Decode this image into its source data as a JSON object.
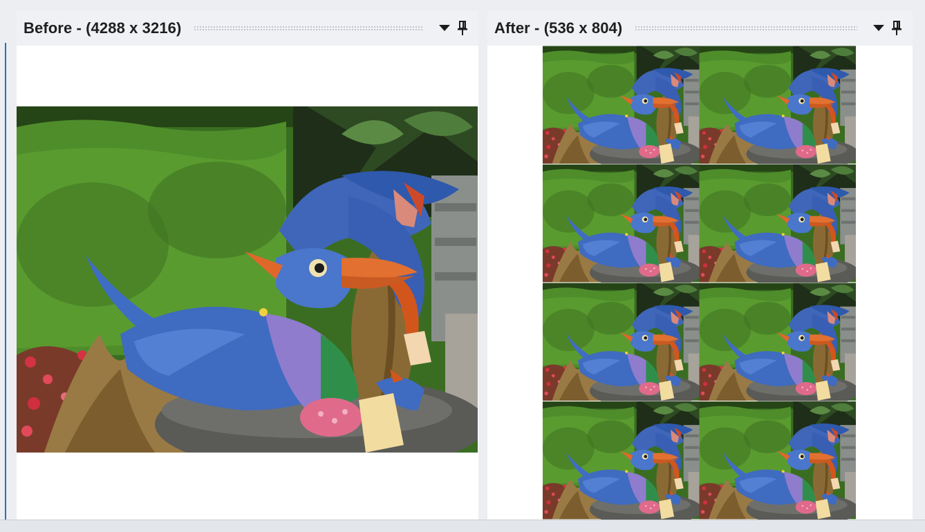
{
  "panels": {
    "before": {
      "title": "Before - (4288 x 3216)",
      "dropdown_icon": "triangle-down-icon",
      "pin_icon": "pin-icon"
    },
    "after": {
      "title": "After - (536 x 804)",
      "dropdown_icon": "triangle-down-icon",
      "pin_icon": "pin-icon",
      "tile_grid": {
        "columns": 2,
        "rows": 4
      }
    }
  },
  "colors": {
    "accent": "#2d6db8",
    "panel_header": "#eff1f4",
    "panel_body": "#ffffff"
  }
}
